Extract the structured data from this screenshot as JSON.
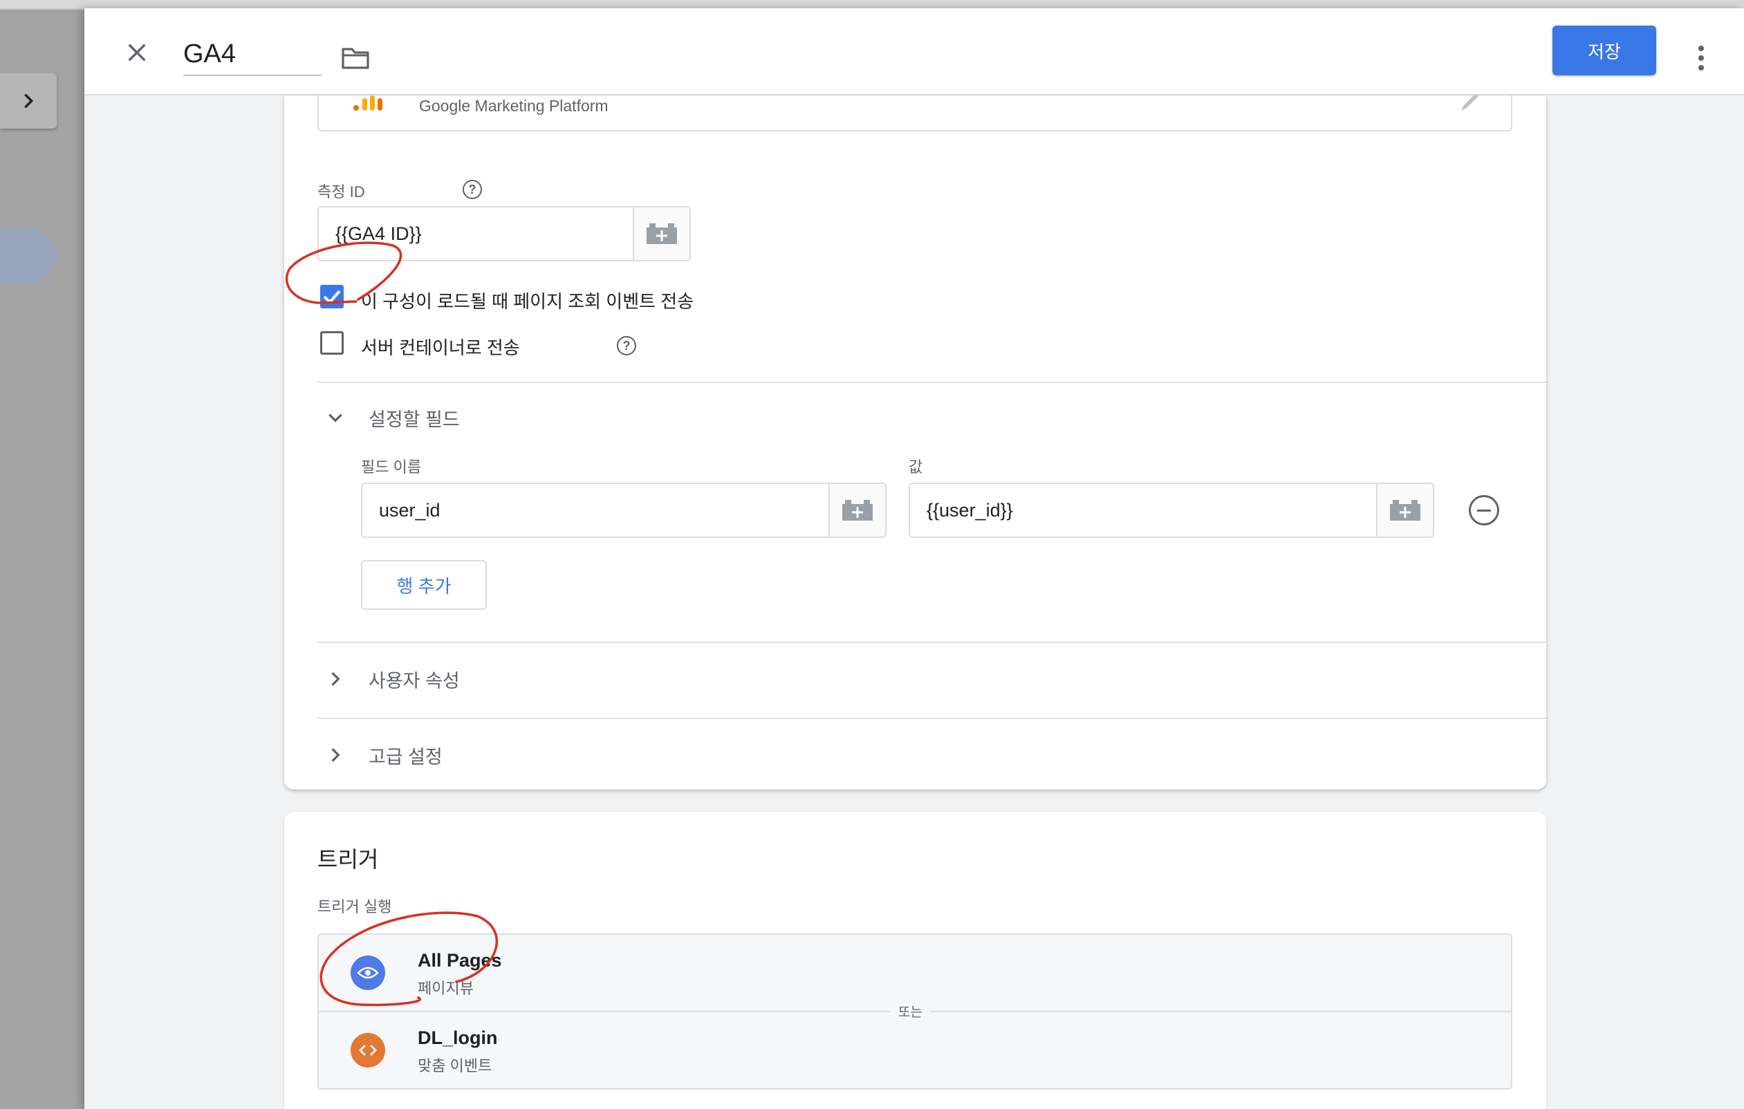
{
  "header": {
    "title": "GA4",
    "save_label": "저장"
  },
  "config": {
    "platform_label": "Google Marketing Platform",
    "measurement_id_label": "측정 ID",
    "measurement_id_value": "{{GA4 ID}}",
    "send_pageview_label": "이 구성이 로드될 때 페이지 조회 이벤트 전송",
    "send_pageview_checked": true,
    "server_container_label": "서버 컨테이너로 전송",
    "server_container_checked": false,
    "fields_section": {
      "title": "설정할 필드",
      "field_name_header": "필드 이름",
      "value_header": "값",
      "rows": [
        {
          "field_name": "user_id",
          "value": "{{user_id}}"
        }
      ],
      "add_row_label": "행 추가"
    },
    "user_properties_label": "사용자 속성",
    "advanced_settings_label": "고급 설정"
  },
  "triggers": {
    "title": "트리거",
    "subtitle": "트리거 실행",
    "or_label": "또는",
    "items": [
      {
        "name": "All Pages",
        "type": "페이지뷰",
        "icon": "eye-icon",
        "color": "#4e7be8"
      },
      {
        "name": "DL_login",
        "type": "맞춤 이벤트",
        "icon": "code-icon",
        "color": "#e27832"
      }
    ]
  },
  "colors": {
    "accent": "#3b78e7",
    "annotation": "#d93025"
  }
}
